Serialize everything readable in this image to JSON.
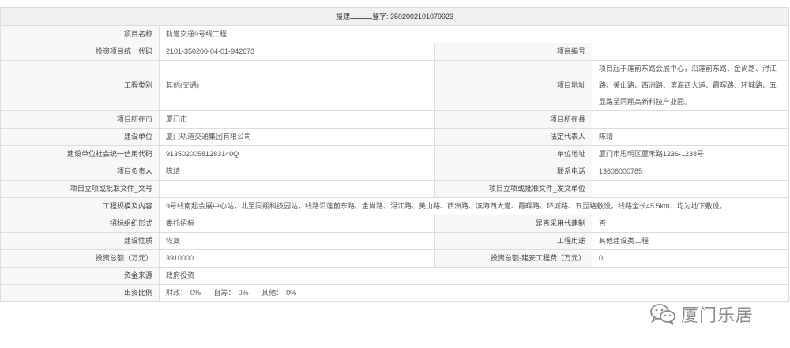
{
  "title": {
    "prefix": "报建",
    "blank": "",
    "suffix": "登字: 3502002101079923"
  },
  "rows": {
    "project_name": {
      "label": "项目名称",
      "value": "轨道交通9号线工程"
    },
    "project_code": {
      "label": "投资项目统一代码",
      "value": "2101-350200-04-01-942673"
    },
    "project_number": {
      "label": "项目编号",
      "value": ""
    },
    "project_category": {
      "label": "工程类别",
      "value": "其他(交通)"
    },
    "project_address": {
      "label": "项目地址",
      "value": "项目起于莲前东路会展中心，沿莲前东路、金尚路、浔江路、美山路、西洲路、滨海西大道、霞晖路、环城路、五显路至同翔高新科技产业园。"
    },
    "city": {
      "label": "项目所在市",
      "value": "厦门市"
    },
    "county": {
      "label": "项目所在县",
      "value": ""
    },
    "builder": {
      "label": "建设单位",
      "value": "厦门轨道交通集团有限公司"
    },
    "legal_rep": {
      "label": "法定代表人",
      "value": "陈靖"
    },
    "credit_code": {
      "label": "建设单位社会统一信用代码",
      "value": "91350200581283140Q"
    },
    "unit_address": {
      "label": "单位地址",
      "value": "厦门市思明区厦禾路1236-1238号"
    },
    "project_lead": {
      "label": "项目负责人",
      "value": "陈靖"
    },
    "phone": {
      "label": "联系电话",
      "value": "13606000785"
    },
    "approval_doc": {
      "label": "项目立项或批准文件_文号",
      "value": ""
    },
    "approval_unit": {
      "label": "项目立项或批准文件_发文单位",
      "value": ""
    },
    "scale": {
      "label": "工程规模及内容",
      "value": "9号线南起会展中心站，北至同翔科技园站，线路沿莲前东路、金尚路、浔江路、美山路、西洲路、滨海西大道、霞晖路、环城路、五显路敷设。线路全长45.5km，均为地下敷设。"
    },
    "bidding": {
      "label": "招标组织形式",
      "value": "委托招标"
    },
    "agent_build": {
      "label": "是否采用代建制",
      "value": "否"
    },
    "nature": {
      "label": "建设性质",
      "value": "恢复"
    },
    "usage": {
      "label": "工程用途",
      "value": "其他建设类工程"
    },
    "total_invest": {
      "label": "投资总额（万元）",
      "value": "3910000"
    },
    "install_cost": {
      "label": "投资总额-建安工程费（万元）",
      "value": "0"
    },
    "fund_source": {
      "label": "资金来源",
      "value": "政府投资"
    },
    "ratio": {
      "label": "出资比例",
      "items": [
        {
          "name": "财政：",
          "value": "0%"
        },
        {
          "name": "自筹：",
          "value": "0%"
        },
        {
          "name": "其他：",
          "value": "0%"
        }
      ]
    }
  },
  "watermark": {
    "icon": "wechat-icon",
    "text": "厦门乐居"
  }
}
